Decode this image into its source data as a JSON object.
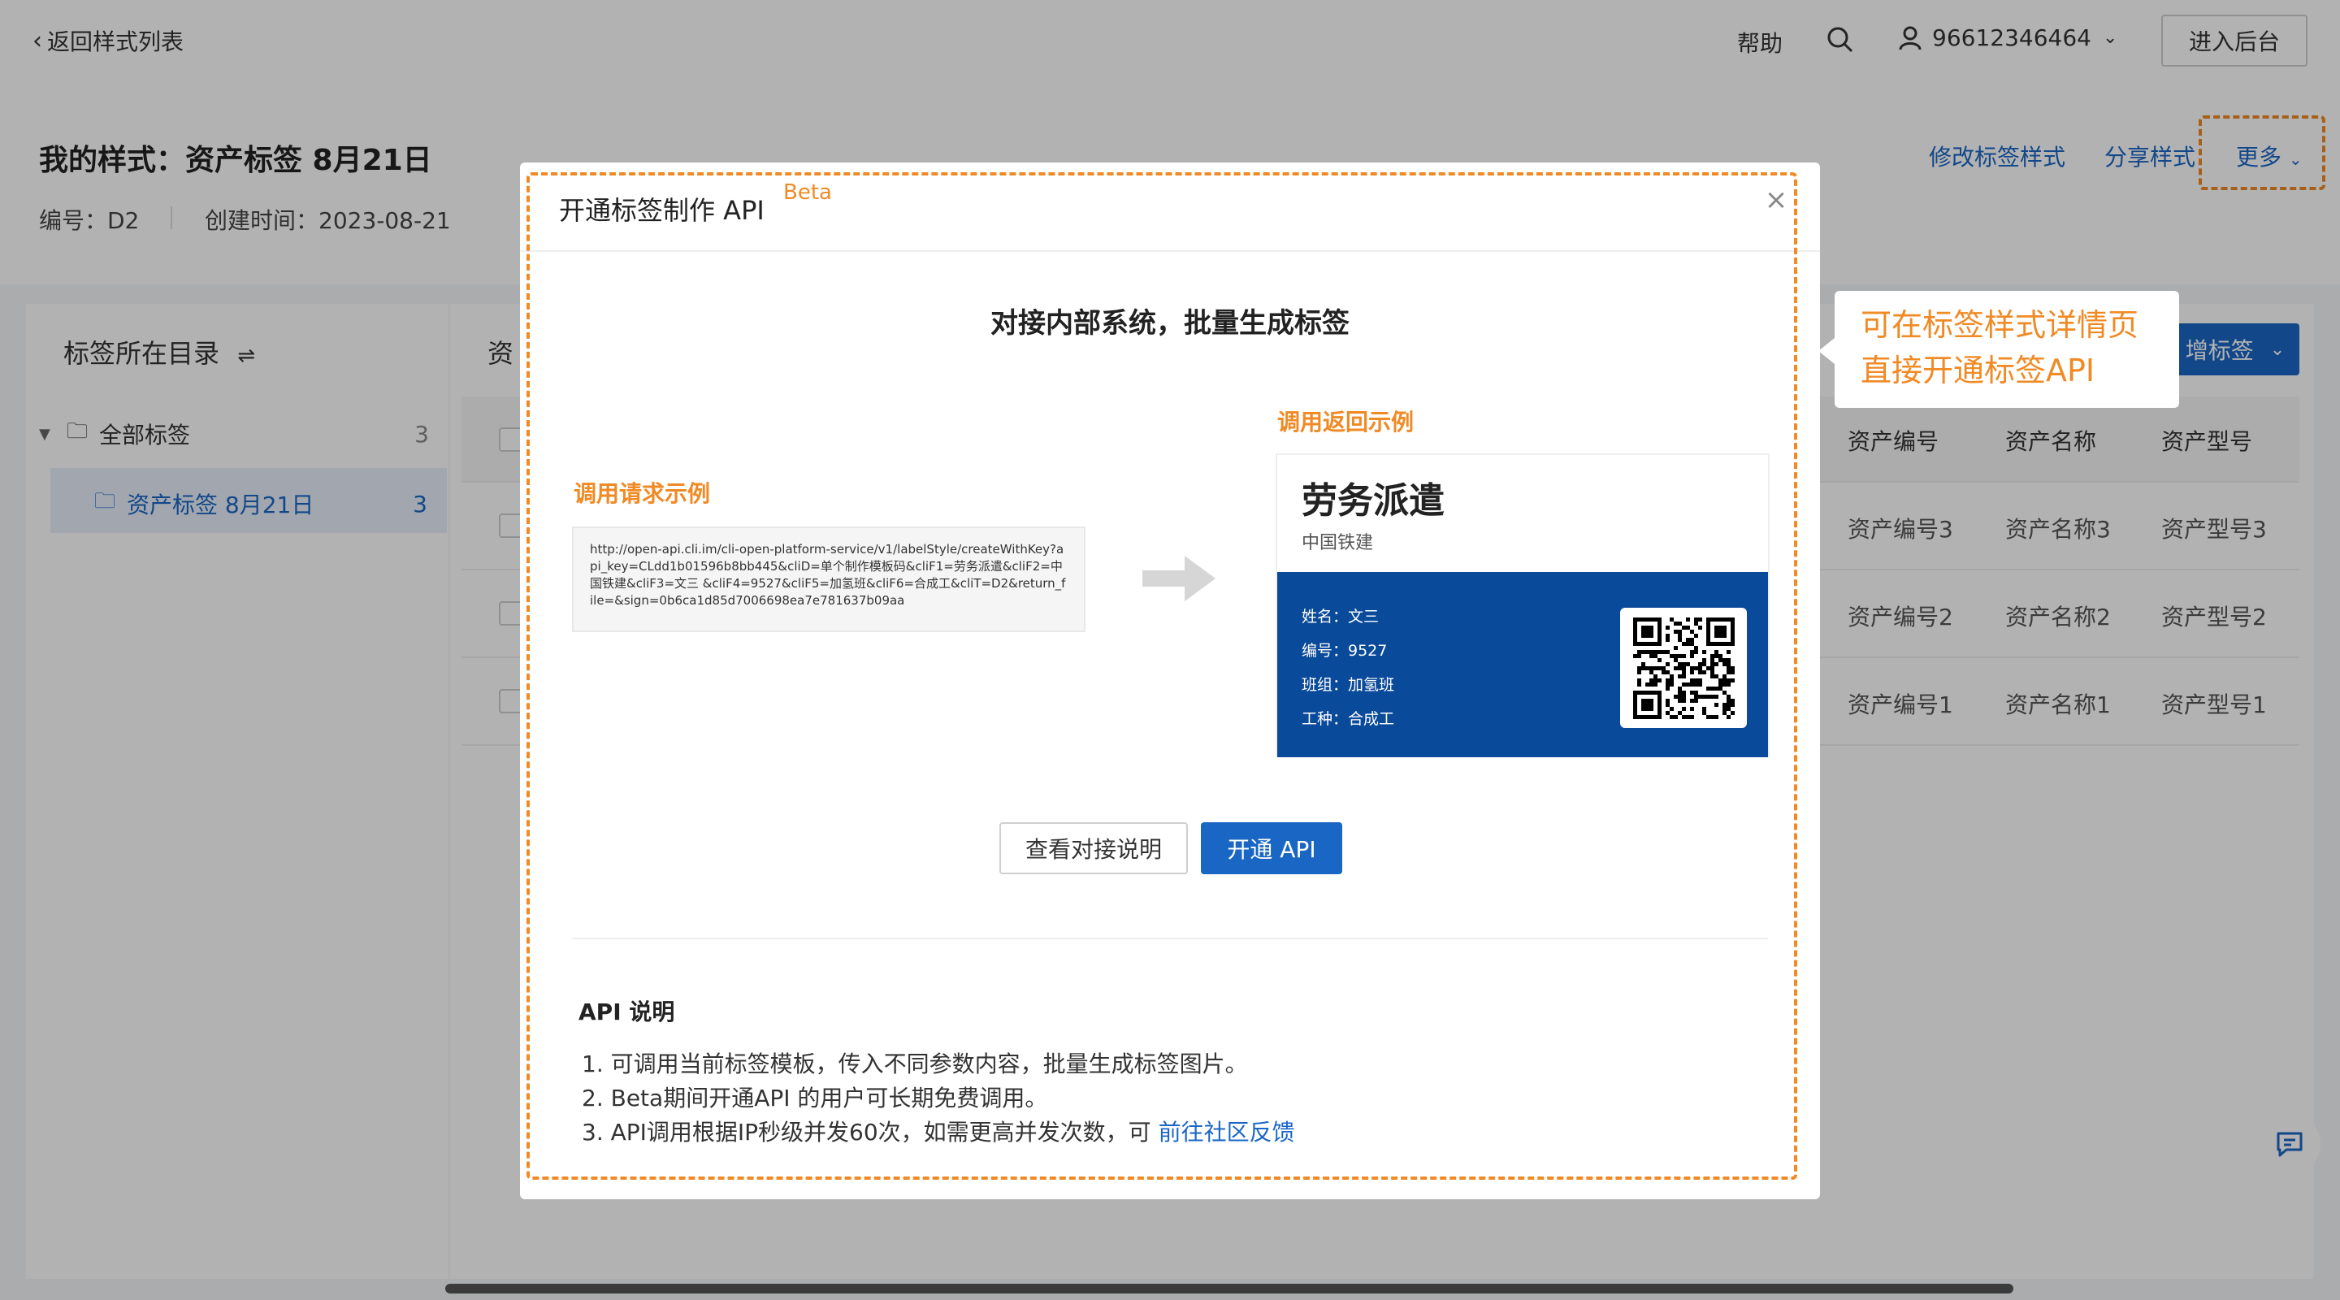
{
  "topbar": {
    "back_label": "返回样式列表",
    "help_label": "帮助",
    "user_id": "96612346464",
    "admin_button": "进入后台"
  },
  "header": {
    "title": "我的样式：资产标签 8月21日",
    "code": "编号：D2",
    "created": "创建时间：2023-08-21",
    "edit_style": "修改标签样式",
    "share_style": "分享样式",
    "more": "更多"
  },
  "sidebar": {
    "title": "标签所在目录",
    "items": [
      {
        "label": "全部标签",
        "count": "3"
      },
      {
        "label": "资产标签 8月21日",
        "count": "3"
      }
    ]
  },
  "main": {
    "tab_partial": "资",
    "add_button_partial": "增标签",
    "columns": [
      "资产编号",
      "资产名称",
      "资产型号"
    ],
    "rows": [
      [
        "资产编号3",
        "资产名称3",
        "资产型号3"
      ],
      [
        "资产编号2",
        "资产名称2",
        "资产型号2"
      ],
      [
        "资产编号1",
        "资产名称1",
        "资产型号1"
      ]
    ]
  },
  "callout": {
    "line1": "可在标签样式详情页",
    "line2": "直接开通标签API"
  },
  "modal": {
    "title": "开通标签制作 API",
    "beta": "Beta",
    "headline": "对接内部系统，批量生成标签",
    "request_label": "调用请求示例",
    "request_url": "http://open-api.cli.im/cli-open-platform-service/v1/labelStyle/createWithKey?api_key=CLdd1b01596b8bb445&cliD=单个制作模板码&cliF1=劳务派遣&cliF2=中国铁建&cliF3=文三 &cliF4=9527&cliF5=加氢班&cliF6=合成工&cliT=D2&return_file=&sign=0b6ca1d85d7006698ea7e781637b09aa",
    "response_label": "调用返回示例",
    "label_card": {
      "title": "劳务派遣",
      "subtitle": "中国铁建",
      "fields": [
        "姓名：文三",
        "编号：9527",
        "班组：加氢班",
        "工种：合成工"
      ]
    },
    "btn_docs": "查看对接说明",
    "btn_open": "开通 API",
    "api_title": "API 说明",
    "notes": [
      "1. 可调用当前标签模板，传入不同参数内容，批量生成标签图片。",
      "2. Beta期间开通API 的用户可长期免费调用。",
      "3. API调用根据IP秒级并发60次，如需更高并发次数，可 "
    ],
    "feedback_link": "前往社区反馈"
  },
  "colors": {
    "accent": "#1a66c4",
    "highlight": "#f08a24",
    "card_blue": "#0a4a9a"
  }
}
